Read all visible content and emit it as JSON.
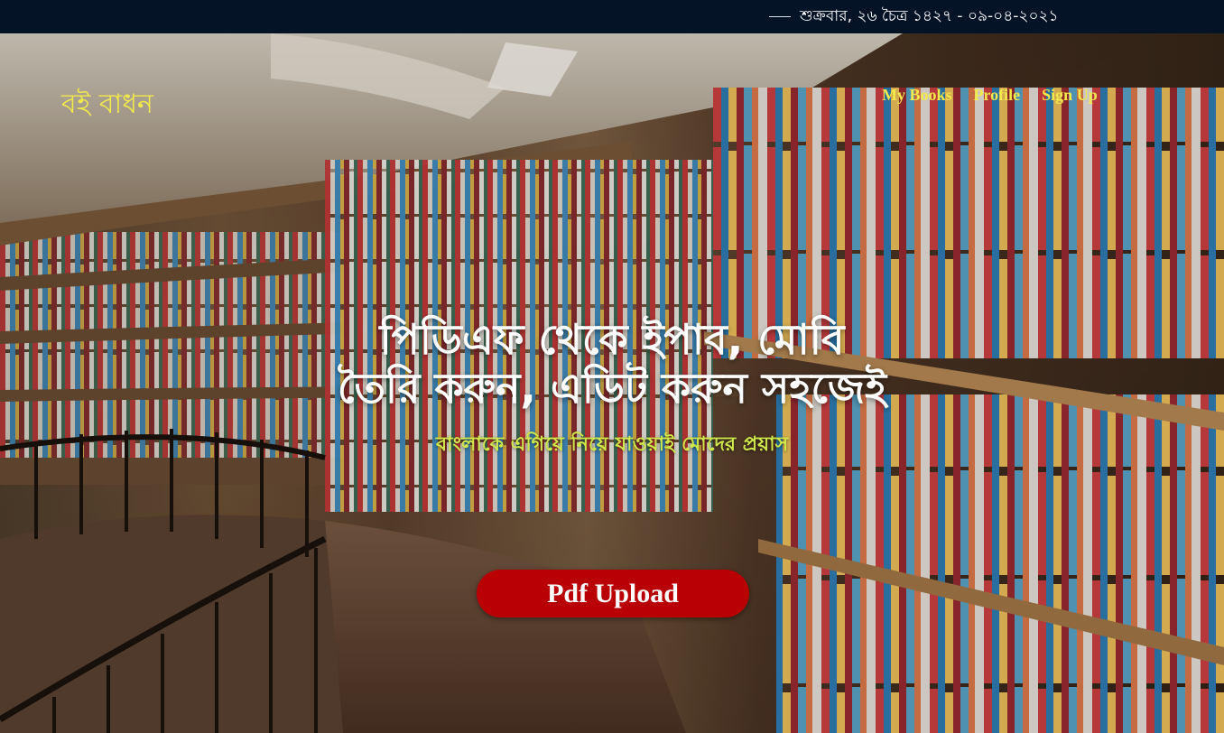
{
  "topbar": {
    "date": "শুক্রবার, ২৬ চৈত্র ১৪২৭  - ০৯-০৪-২০২১"
  },
  "brand": {
    "name": "বই বাধন"
  },
  "nav": {
    "items": [
      {
        "label": "My Books"
      },
      {
        "label": "Profile"
      },
      {
        "label": "Sign Up"
      }
    ]
  },
  "hero": {
    "headline_line1": "পিডিএফ থেকে ইপাব, মোবি",
    "headline_line2": "তৈরি করুন, এডিট করুন সহজেই",
    "subtitle": "বাংলাকে এগিয়ে নিয়ে যাওয়াই মোদের প্রয়াস",
    "button_label": "Pdf Upload"
  },
  "colors": {
    "accent_yellow": "#f2e94a",
    "subtitle_green": "#cfe94a",
    "button_red": "#b90004",
    "topbar_bg": "#041426"
  }
}
